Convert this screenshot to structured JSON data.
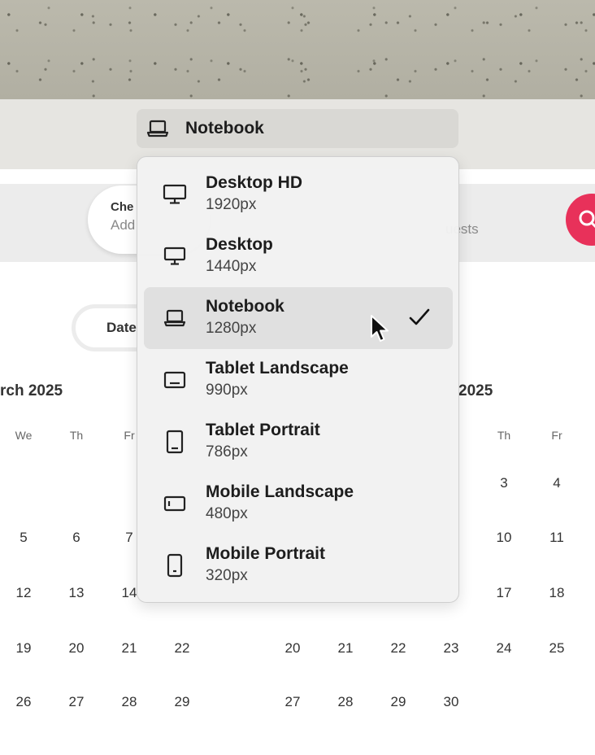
{
  "viewport_selector": {
    "current_label": "Notebook",
    "current_icon": "laptop-icon"
  },
  "dropdown": {
    "options": [
      {
        "name": "Desktop HD",
        "size": "1920px",
        "icon": "desktop-icon",
        "selected": false
      },
      {
        "name": "Desktop",
        "size": "1440px",
        "icon": "desktop-icon",
        "selected": false
      },
      {
        "name": "Notebook",
        "size": "1280px",
        "icon": "laptop-icon",
        "selected": true
      },
      {
        "name": "Tablet Landscape",
        "size": "990px",
        "icon": "tablet-landscape-icon",
        "selected": false
      },
      {
        "name": "Tablet Portrait",
        "size": "786px",
        "icon": "tablet-portrait-icon",
        "selected": false
      },
      {
        "name": "Mobile Landscape",
        "size": "480px",
        "icon": "mobile-landscape-icon",
        "selected": false
      },
      {
        "name": "Mobile Portrait",
        "size": "320px",
        "icon": "mobile-portrait-icon",
        "selected": false
      }
    ]
  },
  "background_page": {
    "check_pill": {
      "label": "Che",
      "value": "Add"
    },
    "guests_text": "uests",
    "dates_tab": "Date",
    "search_button_color": "#e8315a",
    "left_month": {
      "title": "rch 2025",
      "dow": [
        "We",
        "Th",
        "Fr"
      ],
      "rows": [
        [
          "5",
          "6",
          "7"
        ],
        [
          "12",
          "13",
          "14"
        ],
        [
          "19",
          "20",
          "21",
          "22"
        ],
        [
          "26",
          "27",
          "28",
          "29"
        ]
      ]
    },
    "right_month": {
      "title": "2025",
      "dow": [
        "Th",
        "Fr"
      ],
      "rows": [
        [
          "3",
          "4"
        ],
        [
          "10",
          "11"
        ],
        [
          "17",
          "18"
        ],
        [
          "20",
          "21",
          "22",
          "23",
          "24",
          "25"
        ],
        [
          "27",
          "28",
          "29",
          "30"
        ]
      ]
    }
  },
  "colors": {
    "accent": "#e8315a",
    "toolbar_bg": "#e6e5e1",
    "selected_bg": "#e0e0e0"
  }
}
